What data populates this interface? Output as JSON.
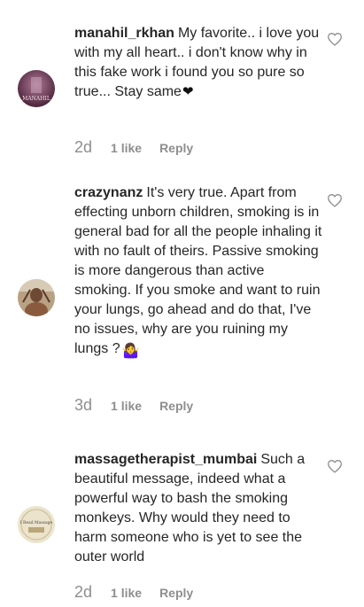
{
  "comments": [
    {
      "username": "manahil_rkhan",
      "text": "My favorite.. i love you with my all heart.. i don't know why in this fake work i found you so pure so true... Stay same",
      "emoji": "❤",
      "time": "2d",
      "likes": "1 like",
      "reply": "Reply",
      "avatar_text": "MANAHIL",
      "avatar_color": "#6b3a58"
    },
    {
      "username": "crazynanz",
      "text": "It's very true. Apart from effecting unborn children, smoking is in general bad for all the people inhaling it with no fault of theirs. Passive smoking is more dangerous than active smoking. If you smoke and want to ruin your lungs, go ahead and do that, I've no issues, why are you ruining my lungs ?",
      "emoji": "🤷‍♀️",
      "time": "3d",
      "likes": "1 like",
      "reply": "Reply",
      "avatar_color": "#a98f73"
    },
    {
      "username": "massagetherapist_mumbai",
      "text": "Such a beautiful message, indeed what a powerful way to bash the smoking monkeys. Why would they need to harm someone who is yet to see the outer world",
      "emoji": "",
      "time": "2d",
      "likes": "1 like",
      "reply": "Reply",
      "avatar_text": "I Read Massage",
      "avatar_color": "#e9e1c9"
    }
  ],
  "colors": {
    "text": "#262626",
    "muted": "#8e8e8e",
    "heart_stroke": "#8e8e8e",
    "emoji_heart": "#111111"
  },
  "icons": {
    "like": "heart-outline-icon"
  }
}
